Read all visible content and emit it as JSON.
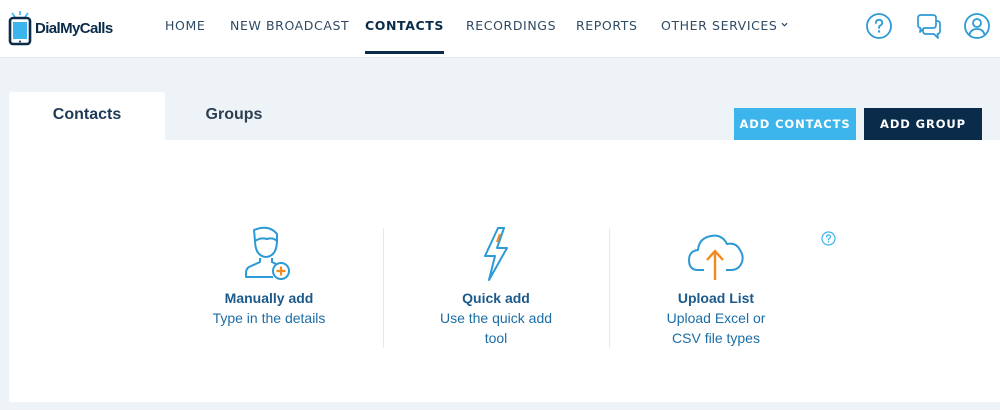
{
  "brand": {
    "name": "DialMyCalls"
  },
  "nav": {
    "items": [
      "HOME",
      "NEW BROADCAST",
      "CONTACTS",
      "RECORDINGS",
      "REPORTS",
      "OTHER SERVICES"
    ],
    "active": "CONTACTS"
  },
  "tabs": [
    "Contacts",
    "Groups"
  ],
  "buttons": {
    "add_contacts": "ADD CONTACTS",
    "add_group": "ADD GROUP"
  },
  "options": [
    {
      "title": "Manually add",
      "desc": "Type in the details",
      "icon": "person-add-icon"
    },
    {
      "title": "Quick add",
      "desc": "Use the quick add tool",
      "icon": "lightning-icon"
    },
    {
      "title": "Upload List",
      "desc": "Upload Excel or CSV file types",
      "icon": "cloud-upload-icon"
    }
  ],
  "colors": {
    "navy": "#0a2b4a",
    "accent": "#3cb4ec",
    "orange": "#f28a1f",
    "link": "#1c5a8c"
  }
}
